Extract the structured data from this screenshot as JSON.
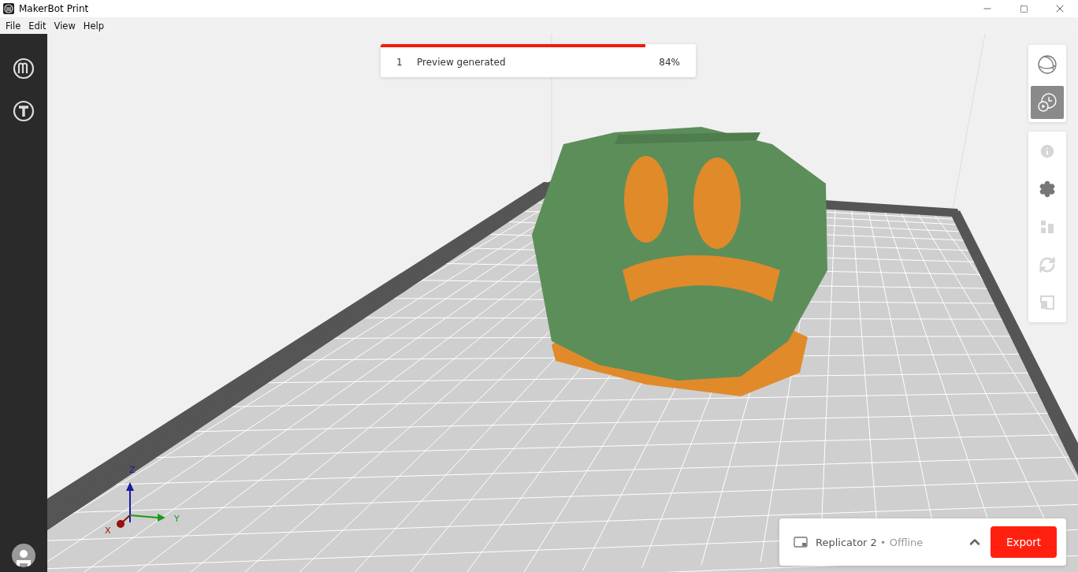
{
  "window": {
    "title": "MakerBot Print"
  },
  "menu": [
    "File",
    "Edit",
    "View",
    "Help"
  ],
  "left_sidebar": {
    "items": [
      {
        "kind": "prepare",
        "selected": false
      },
      {
        "kind": "thingiverse",
        "selected": false
      }
    ]
  },
  "progress": {
    "step": "1",
    "label": "Preview generated",
    "percent": "84%",
    "level": 0.84
  },
  "view_tools": [
    {
      "kind": "view",
      "selected": false
    },
    {
      "kind": "preview",
      "selected": true
    }
  ],
  "edit_tools": [
    {
      "kind": "info",
      "disabled": true
    },
    {
      "kind": "settings",
      "disabled": false
    },
    {
      "kind": "arrange",
      "disabled": true
    },
    {
      "kind": "rotate",
      "disabled": true
    },
    {
      "kind": "scale",
      "disabled": true
    }
  ],
  "axes": {
    "x": "X",
    "y": "Y",
    "z": "Z"
  },
  "printer": {
    "name": "Replicator 2",
    "status": "• Offline",
    "export": "Export"
  }
}
